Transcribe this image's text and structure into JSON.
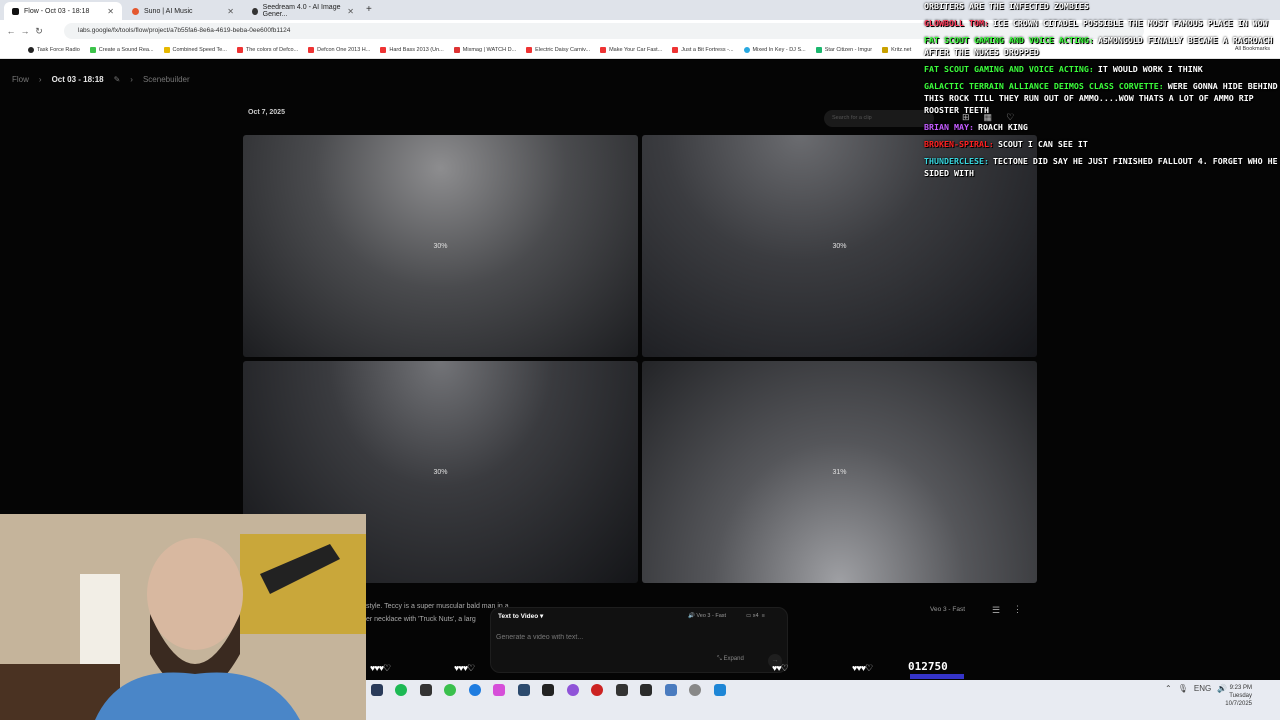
{
  "tabs": [
    {
      "title": "Flow - Oct 03 - 18:18",
      "active": true
    },
    {
      "title": "Suno | AI Music",
      "active": false
    },
    {
      "title": "Seedream 4.0 - AI Image Gener...",
      "active": false
    }
  ],
  "address": "labs.google/fx/tools/flow/project/a7b55fa6-8e6a-4619-beba-0ee600fb1124",
  "bookmarks": [
    "Task Force Radio",
    "Create a Sound Rea...",
    "Combined Speed Te...",
    "The colors of Defco...",
    "Defcon One 2013 H...",
    "Hard Bass 2013 (Un...",
    "Mixmag | WATCH D...",
    "Electric Daisy Carniv...",
    "Make Your Car Fast...",
    "Just a Bit Fortress -...",
    "Mixed In Key - DJ S...",
    "Star Citizen - Imgur",
    "Kritz.net"
  ],
  "all_bookmarks": "All Bookmarks",
  "breadcrumb": {
    "root": "Flow",
    "current": "Oct 03 - 18:18",
    "next": "Scenebuilder"
  },
  "date_header": "Oct 7, 2025",
  "search_placeholder": "Search for a clip",
  "tiles": [
    "30%",
    "30%",
    "30%",
    "31%"
  ],
  "prompt_preview": {
    "line1": "style. Teccy is a super muscular bald man in a...",
    "line2": "er necklace with 'Truck Nuts', a larg"
  },
  "model_label": "Veo 3 - Fast",
  "composer": {
    "mode": "Text to Video",
    "model": "Veo 3 - Fast",
    "count": "x4",
    "placeholder": "Generate a video with text...",
    "expand": "Expand"
  },
  "chat": [
    {
      "user": "",
      "color": "#ffffff",
      "text": "ORBITERS ARE THE INFECTED ZOMBIES"
    },
    {
      "user": "GLOWBOLL TOM:",
      "color": "#ff3b5c",
      "text": "ICE CROWN CITADEL POSSIBLE THE MOST FAMOUS PLACE IN WOW"
    },
    {
      "user": "FAT SCOUT GAMING AND VOICE ACTING:",
      "color": "#3cff3c",
      "text": "ASMONGOLD FINALLY BECAME A RAGROACH AFTER THE NUKES DROPPED"
    },
    {
      "user": "FAT SCOUT GAMING AND VOICE ACTING:",
      "color": "#3cff3c",
      "text": "IT WOULD WORK I THINK"
    },
    {
      "user": "GALACTIC TERRAIN ALLIANCE DEIMOS CLASS CORVETTE:",
      "color": "#3cff3c",
      "text": "WERE GONNA HIDE BEHIND THIS ROCK TILL THEY RUN OUT OF AMMO....WOW THATS A LOT OF AMMO RIP ROOSTER TEETH"
    },
    {
      "user": "BRIAN MAY:",
      "color": "#c45cff",
      "text": "ROACH KING"
    },
    {
      "user": "BROKEN-SPIRAL:",
      "color": "#ff2020",
      "text": "SCOUT I CAN SEE IT"
    },
    {
      "user": "THUNDERCLESE:",
      "color": "#38d7e0",
      "text": "TECTONE DID SAY HE JUST FINISHED FALLOUT 4. FORGET WHO HE SIDED WITH"
    }
  ],
  "score": "012750",
  "clock": {
    "time": "9:23 PM",
    "day": "Tuesday",
    "date": "10/7/2025",
    "lang": "ENG"
  }
}
